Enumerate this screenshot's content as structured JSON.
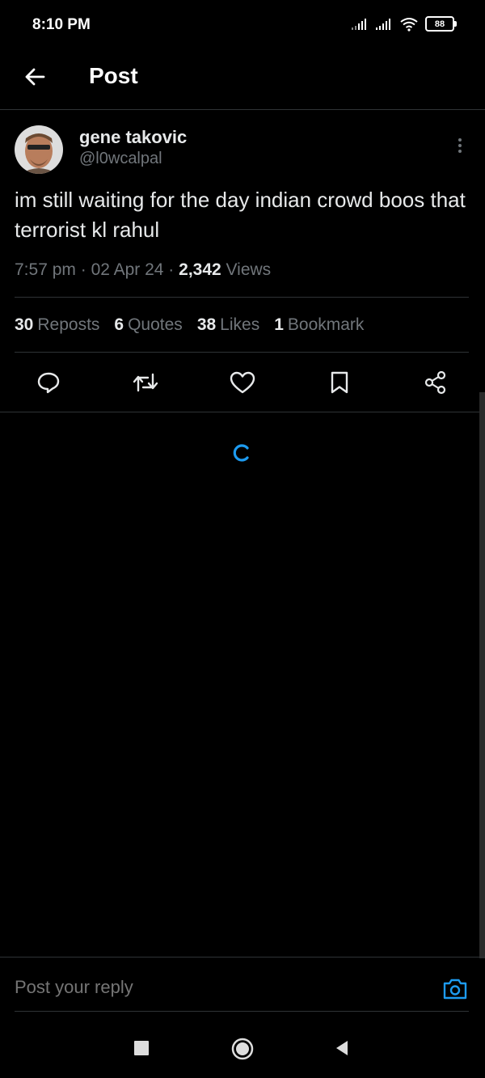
{
  "status_bar": {
    "time": "8:10 PM",
    "battery": "88",
    "icons": [
      "signal-icon",
      "signal-icon",
      "wifi-icon",
      "battery-icon"
    ]
  },
  "header": {
    "title": "Post",
    "back_icon": "arrow-left-icon"
  },
  "post": {
    "author_name": "gene takovic",
    "author_handle": "@l0wcalpal",
    "text": "im still waiting for the day indian crowd boos that terrorist kl rahul",
    "time": "7:57 pm",
    "date": "02 Apr 24",
    "views_count": "2,342",
    "views_label": "Views",
    "stats": [
      {
        "count": "30",
        "label": "Reposts"
      },
      {
        "count": "6",
        "label": "Quotes"
      },
      {
        "count": "38",
        "label": "Likes"
      },
      {
        "count": "1",
        "label": "Bookmark"
      }
    ],
    "actions": [
      "reply-icon",
      "repost-icon",
      "like-icon",
      "bookmark-icon",
      "share-icon"
    ]
  },
  "reply": {
    "placeholder": "Post your reply"
  },
  "colors": {
    "background": "#000000",
    "text": "#e7e9ea",
    "muted": "#71767b",
    "accent": "#1d9bf0",
    "divider": "#2f3336"
  }
}
